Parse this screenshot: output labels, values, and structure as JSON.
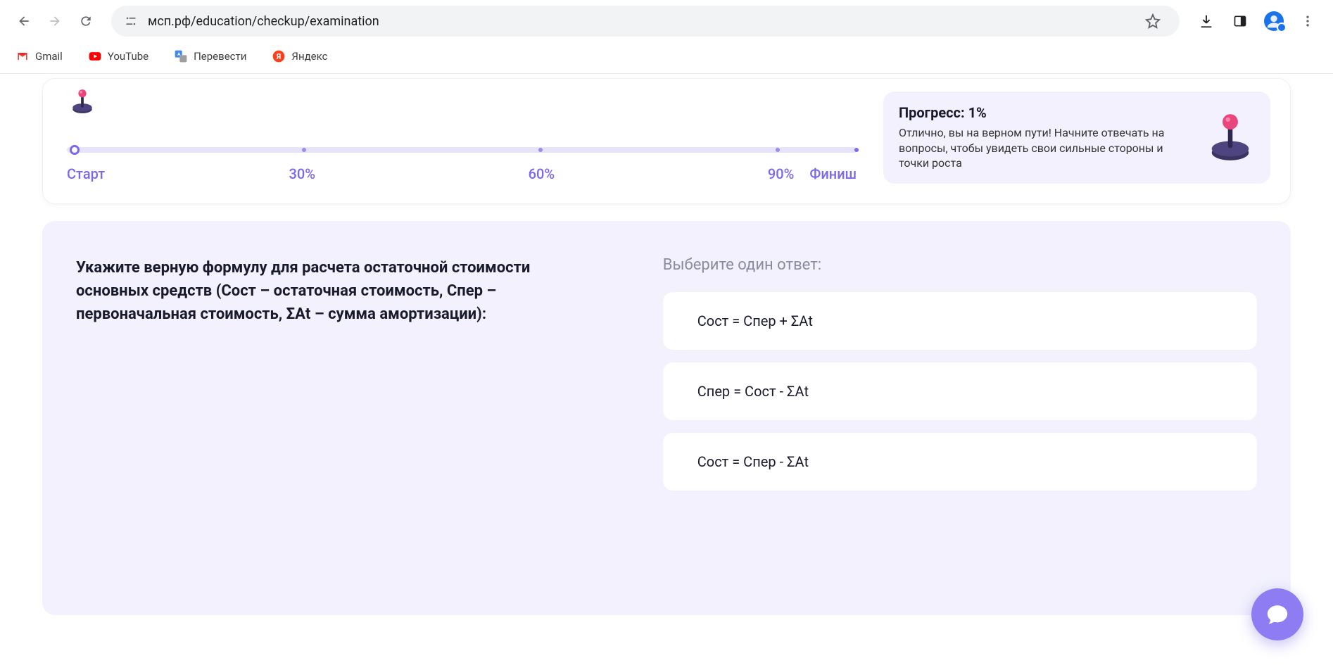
{
  "browser": {
    "url": "мсп.рф/education/checkup/examination"
  },
  "bookmarks": [
    {
      "label": "Gmail",
      "icon": "gmail"
    },
    {
      "label": "YouTube",
      "icon": "youtube"
    },
    {
      "label": "Перевести",
      "icon": "translate"
    },
    {
      "label": "Яндекс",
      "icon": "yandex"
    }
  ],
  "progress": {
    "labels": {
      "start": "Старт",
      "p30": "30%",
      "p60": "60%",
      "p90": "90%",
      "finish": "Финиш"
    },
    "info": {
      "title": "Прогресс: 1%",
      "desc": "Отлично, вы на верном пути! Начните отвечать на вопросы, чтобы увидеть свои сильные стороны и точки роста"
    }
  },
  "question": {
    "text": "Укажите верную формулу для расчета остаточной стоимости основных средств (Сост – остаточная стоимость, Спер – первоначальная стоимость, ΣАt – сумма амортизации):",
    "answers_title": "Выберите один ответ:",
    "options": [
      "Сост = Спер + ΣАt",
      "Спер = Сост - ΣАt",
      "Сост = Спер - ΣАt"
    ]
  }
}
